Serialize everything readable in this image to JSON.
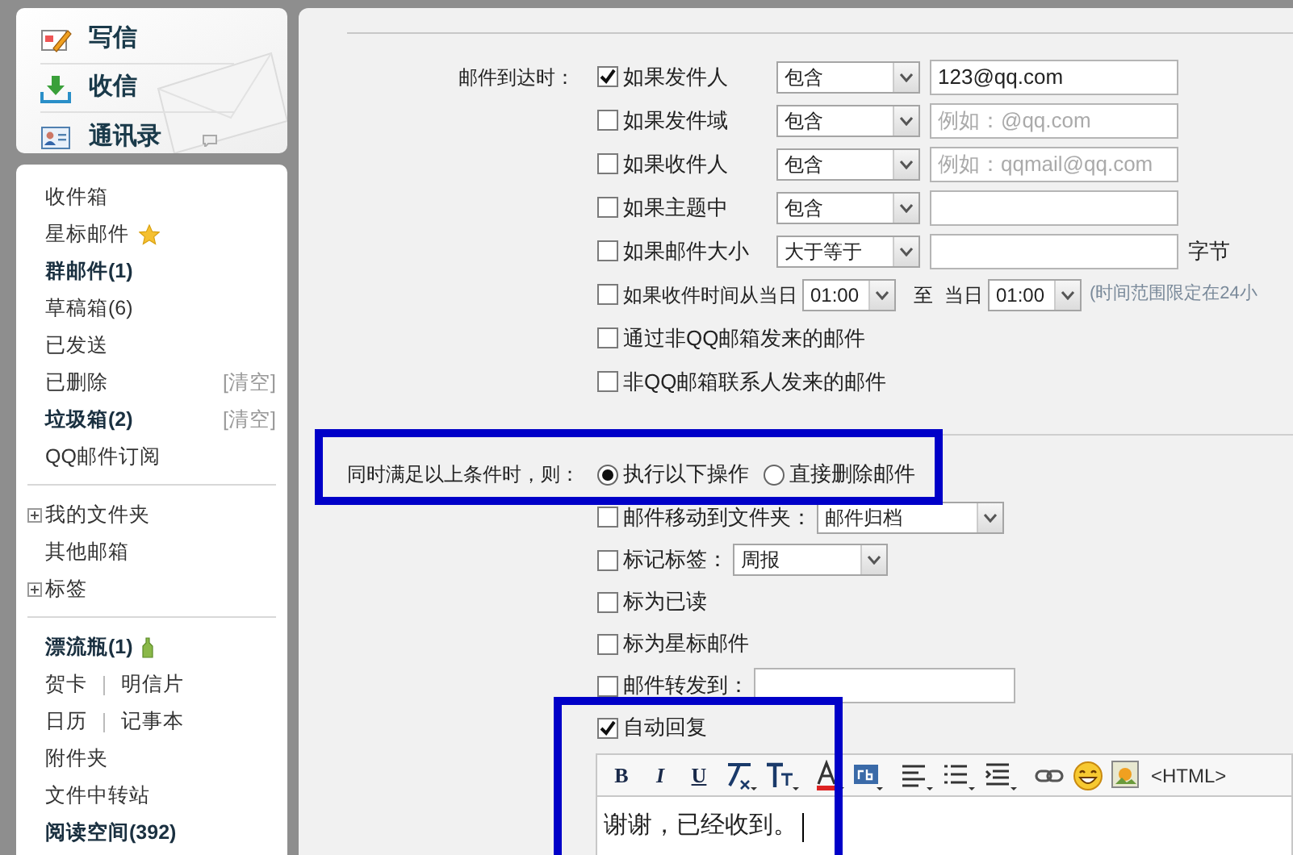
{
  "quick_actions": [
    {
      "label": "写信"
    },
    {
      "label": "收信"
    },
    {
      "label": "通讯录"
    }
  ],
  "folders": [
    [
      {
        "label": "收件箱",
        "bold": false
      },
      {
        "kind": "starred",
        "label": "星标邮件",
        "bold": false
      },
      {
        "label": "群邮件(1)",
        "bold": true
      },
      {
        "label": "草稿箱(6)",
        "bold": false
      },
      {
        "label": "已发送",
        "bold": false
      },
      {
        "label": "已删除",
        "bold": false,
        "action": "[清空]"
      },
      {
        "label": "垃圾箱(2)",
        "bold": true,
        "action": "[清空]"
      },
      {
        "label": "QQ邮件订阅",
        "bold": false
      }
    ],
    [
      {
        "label": "我的文件夹",
        "bold": false,
        "expandable": true
      },
      {
        "label": "其他邮箱",
        "bold": false
      },
      {
        "label": "标签",
        "bold": false,
        "expandable": true
      }
    ],
    [
      {
        "kind": "bottle",
        "label": "漂流瓶(1)",
        "bold": true
      },
      {
        "kind": "pair",
        "links": [
          "贺卡",
          "明信片"
        ]
      },
      {
        "kind": "pair",
        "links": [
          "日历",
          "记事本"
        ]
      },
      {
        "label": "附件夹",
        "bold": false
      },
      {
        "label": "文件中转站",
        "bold": false
      },
      {
        "label": "阅读空间(392)",
        "bold": true
      }
    ]
  ],
  "conditions": {
    "label": "邮件到达时：",
    "rows": [
      {
        "kind": "match",
        "checked": true,
        "label": "如果发件人",
        "operator": "包含",
        "value": "123@qq.com"
      },
      {
        "kind": "match",
        "checked": false,
        "label": "如果发件域",
        "operator": "包含",
        "placeholder": "例如：@qq.com"
      },
      {
        "kind": "match",
        "checked": false,
        "label": "如果收件人",
        "operator": "包含",
        "placeholder": "例如：qqmail@qq.com"
      },
      {
        "kind": "match",
        "checked": false,
        "label": "如果主题中",
        "operator": "包含"
      },
      {
        "kind": "match",
        "checked": false,
        "label": "如果邮件大小",
        "operator": "大于等于",
        "suffix": "字节"
      },
      {
        "kind": "time",
        "checked": false,
        "label": "如果收件时间从当日",
        "from": "01:00",
        "to_label": "至",
        "day_label": "当日",
        "to": "01:00",
        "note": "(时间范围限定在24小"
      },
      {
        "kind": "plain",
        "checked": false,
        "label": "通过非QQ邮箱发来的邮件"
      },
      {
        "kind": "plain",
        "checked": false,
        "label": "非QQ邮箱联系人发来的邮件"
      }
    ]
  },
  "actions": {
    "label": "同时满足以上条件时，则：",
    "modes": [
      {
        "label": "执行以下操作",
        "selected": true
      },
      {
        "label": "直接删除邮件",
        "selected": false
      }
    ],
    "rows": [
      {
        "kind": "select",
        "checked": false,
        "label": "邮件移动到文件夹：",
        "value": "邮件归档"
      },
      {
        "kind": "select",
        "checked": false,
        "label": "标记标签：",
        "value": "周报"
      },
      {
        "kind": "plain",
        "checked": false,
        "label": "标为已读"
      },
      {
        "kind": "plain",
        "checked": false,
        "label": "标为星标邮件"
      },
      {
        "kind": "input",
        "checked": false,
        "label": "邮件转发到："
      },
      {
        "kind": "plain",
        "checked": true,
        "label": "自动回复"
      }
    ]
  },
  "editor": {
    "format_buttons": [
      "B",
      "I",
      "U"
    ],
    "html_toggle": "<HTML>",
    "text": "谢谢，已经收到。"
  }
}
